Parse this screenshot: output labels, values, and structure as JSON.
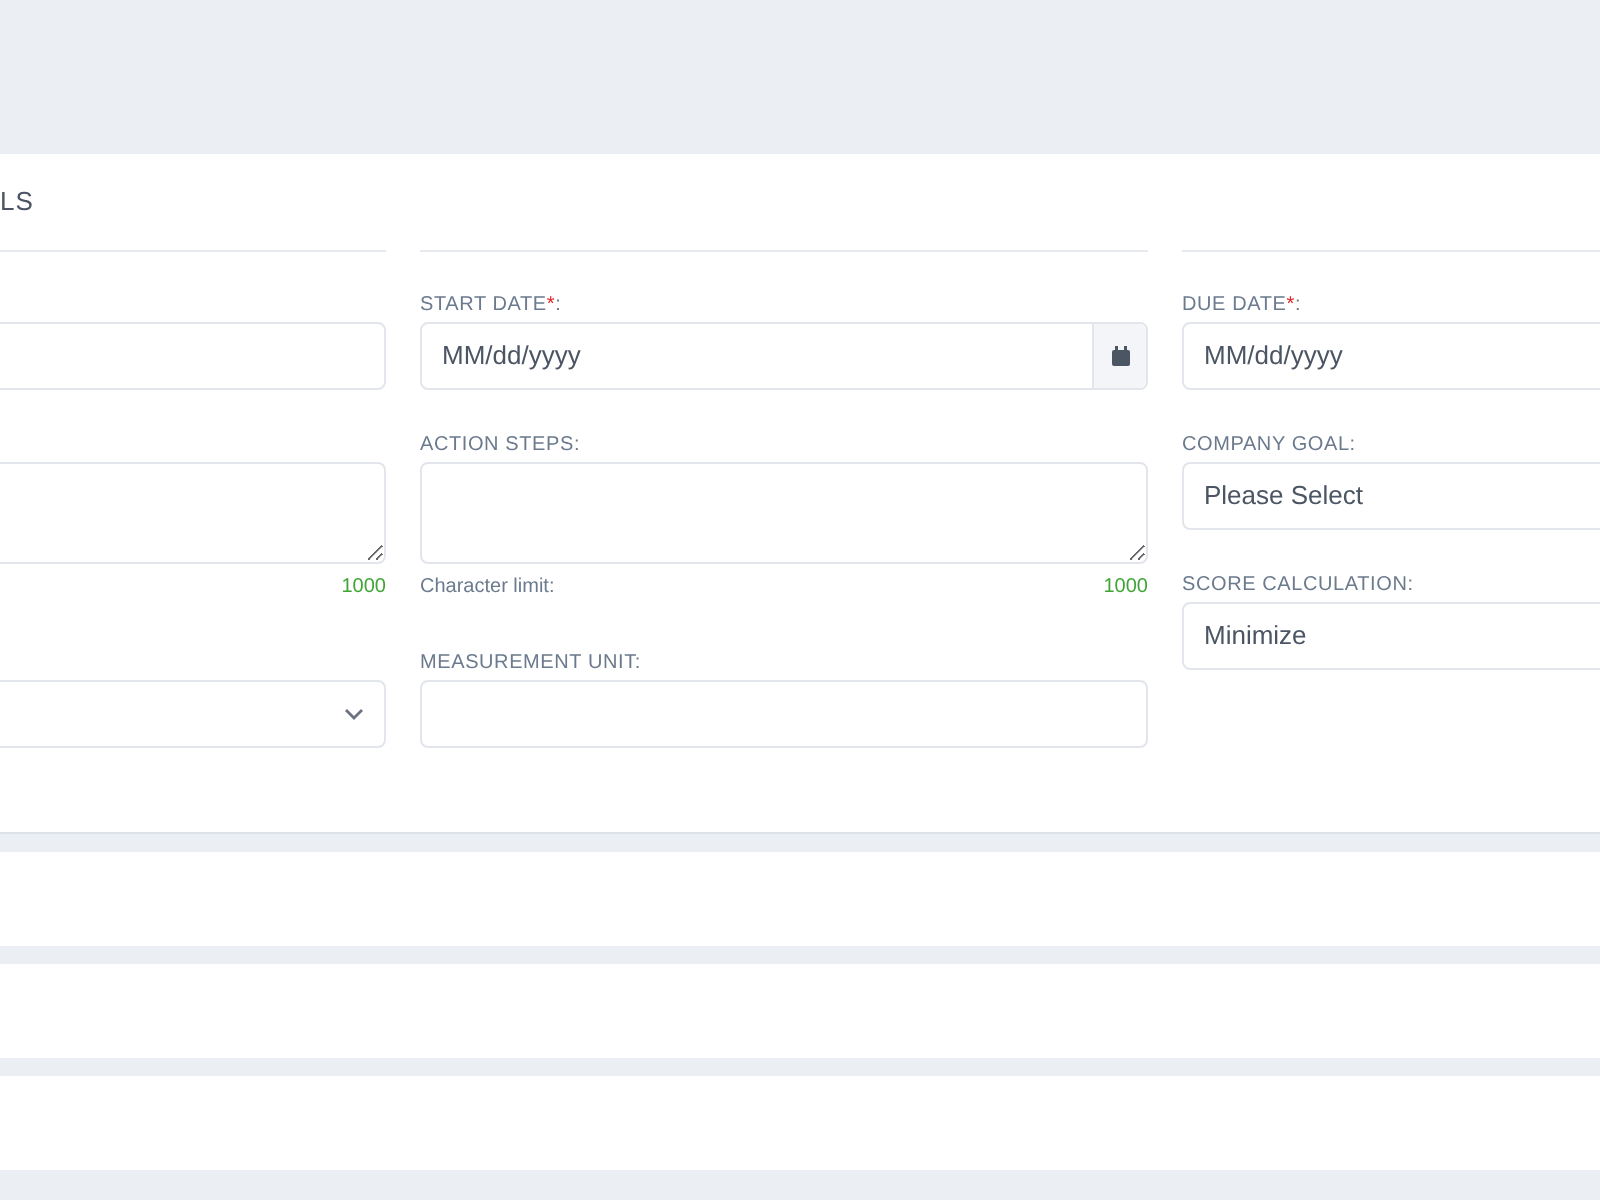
{
  "section_title": "LS",
  "columns": [
    {
      "fields": [
        {
          "kind": "input"
        },
        {
          "kind": "textarea",
          "counter": "1000"
        },
        {
          "kind": "select",
          "chevron": true
        }
      ]
    },
    {
      "fields": [
        {
          "kind": "date",
          "label": "START DATE",
          "required": true,
          "required_mark": "*",
          "label_suffix": ":",
          "placeholder": "MM/dd/yyyy",
          "calendar_button": true
        },
        {
          "kind": "textarea",
          "label": "ACTION STEPS:",
          "limit_label": "Character limit:",
          "counter": "1000"
        },
        {
          "kind": "input",
          "label": "MEASUREMENT UNIT:"
        }
      ]
    },
    {
      "fields": [
        {
          "kind": "date",
          "label": "DUE DATE",
          "required": true,
          "required_mark": "*",
          "label_suffix": ":",
          "placeholder": "MM/dd/yyyy"
        },
        {
          "kind": "select",
          "label": "COMPANY GOAL:",
          "value": "Please Select"
        },
        {
          "kind": "select",
          "label": "SCORE CALCULATION:",
          "value": "Minimize"
        }
      ]
    }
  ],
  "collapsed_panels": [
    {
      "kind": "panel"
    },
    {
      "kind": "panel"
    },
    {
      "kind": "panel"
    }
  ]
}
